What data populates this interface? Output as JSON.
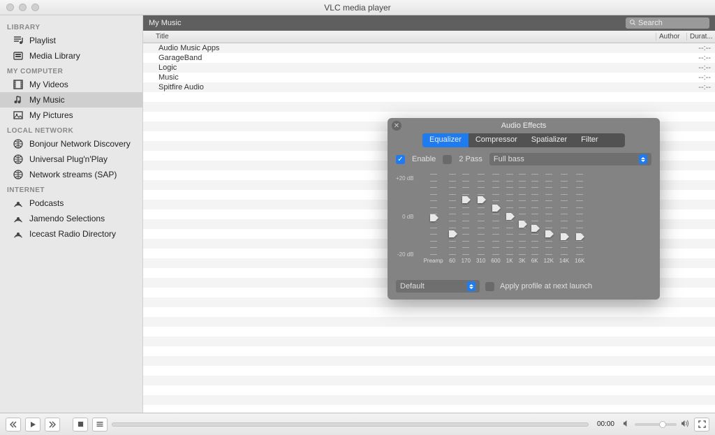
{
  "window_title": "VLC media player",
  "sidebar": [
    {
      "group": "LIBRARY",
      "items": [
        {
          "icon": "playlist",
          "label": "Playlist"
        },
        {
          "icon": "media",
          "label": "Media Library"
        }
      ]
    },
    {
      "group": "MY COMPUTER",
      "items": [
        {
          "icon": "film",
          "label": "My Videos"
        },
        {
          "icon": "music",
          "label": "My Music",
          "selected": true
        },
        {
          "icon": "picture",
          "label": "My Pictures"
        }
      ]
    },
    {
      "group": "LOCAL NETWORK",
      "items": [
        {
          "icon": "globe",
          "label": "Bonjour Network Discovery"
        },
        {
          "icon": "globe",
          "label": "Universal Plug'n'Play"
        },
        {
          "icon": "globe",
          "label": "Network streams (SAP)"
        }
      ]
    },
    {
      "group": "INTERNET",
      "items": [
        {
          "icon": "podcast",
          "label": "Podcasts"
        },
        {
          "icon": "podcast",
          "label": "Jamendo Selections"
        },
        {
          "icon": "podcast",
          "label": "Icecast Radio Directory"
        }
      ]
    }
  ],
  "breadcrumb": "My Music",
  "search_placeholder": "Search",
  "columns": {
    "title": "Title",
    "author": "Author",
    "duration": "Durat..."
  },
  "rows": [
    {
      "title": "Audio Music Apps",
      "duration": "--:--"
    },
    {
      "title": "GarageBand",
      "duration": "--:--"
    },
    {
      "title": "Logic",
      "duration": "--:--"
    },
    {
      "title": "Music",
      "duration": "--:--"
    },
    {
      "title": "Spitfire Audio",
      "duration": "--:--"
    }
  ],
  "audio_effects": {
    "title": "Audio Effects",
    "tabs": [
      "Equalizer",
      "Compressor",
      "Spatializer",
      "Filter"
    ],
    "active_tab": 0,
    "enable_label": "Enable",
    "enable_checked": true,
    "twopass_label": "2 Pass",
    "twopass_checked": false,
    "preset": "Full bass",
    "scale": {
      "top": "+20 dB",
      "mid": "0 dB",
      "bot": "-20 dB"
    },
    "bands": [
      {
        "label": "Preamp",
        "pos": 50
      },
      {
        "label": "60",
        "pos": 70
      },
      {
        "label": "170",
        "pos": 28
      },
      {
        "label": "310",
        "pos": 28
      },
      {
        "label": "600",
        "pos": 38
      },
      {
        "label": "1K",
        "pos": 48
      },
      {
        "label": "3K",
        "pos": 58
      },
      {
        "label": "6K",
        "pos": 63
      },
      {
        "label": "12K",
        "pos": 70
      },
      {
        "label": "14K",
        "pos": 73
      },
      {
        "label": "16K",
        "pos": 73
      }
    ],
    "profile": "Default",
    "apply_label": "Apply profile at next launch"
  },
  "player": {
    "time": "00:00"
  }
}
